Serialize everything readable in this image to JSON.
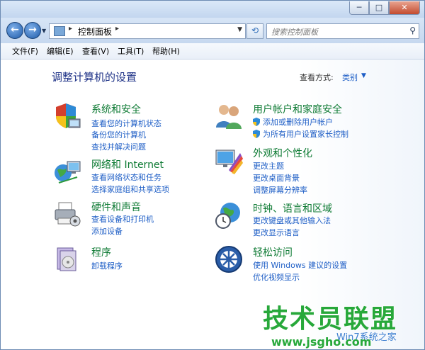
{
  "window": {
    "caption_buttons": {
      "minimize": "─",
      "maximize": "□",
      "close": "✕"
    }
  },
  "navigation": {
    "back_icon": "back-arrow-icon",
    "forward_icon": "forward-arrow-icon",
    "address": {
      "path": "控制面板"
    },
    "search_placeholder": "搜索控制面板"
  },
  "menu": [
    "文件(F)",
    "编辑(E)",
    "查看(V)",
    "工具(T)",
    "帮助(H)"
  ],
  "content": {
    "heading": "调整计算机的设置",
    "view_by_label": "查看方式:",
    "view_by_value": "类别"
  },
  "categories": {
    "system_security": {
      "title": "系统和安全",
      "links": [
        "查看您的计算机状态",
        "备份您的计算机",
        "查找并解决问题"
      ]
    },
    "network_internet": {
      "title": "网络和 Internet",
      "links": [
        "查看网络状态和任务",
        "选择家庭组和共享选项"
      ]
    },
    "hardware_sound": {
      "title": "硬件和声音",
      "links": [
        "查看设备和打印机",
        "添加设备"
      ]
    },
    "programs": {
      "title": "程序",
      "links": [
        "卸载程序"
      ]
    },
    "user_accounts": {
      "title": "用户帐户和家庭安全",
      "links": [
        "添加或删除用户帐户",
        "为所有用户设置家长控制"
      ]
    },
    "appearance": {
      "title": "外观和个性化",
      "links": [
        "更改主题",
        "更改桌面背景",
        "调整屏幕分辨率"
      ]
    },
    "clock_region": {
      "title": "时钟、语言和区域",
      "links": [
        "更改键盘或其他输入法",
        "更改显示语言"
      ]
    },
    "ease_of_access": {
      "title": "轻松访问",
      "links": [
        "使用 Windows 建议的设置",
        "优化视频显示"
      ]
    }
  },
  "watermark": {
    "title": "技术员联盟",
    "subtitle": "Win7系统之家",
    "url": "www.jsgho.com"
  }
}
